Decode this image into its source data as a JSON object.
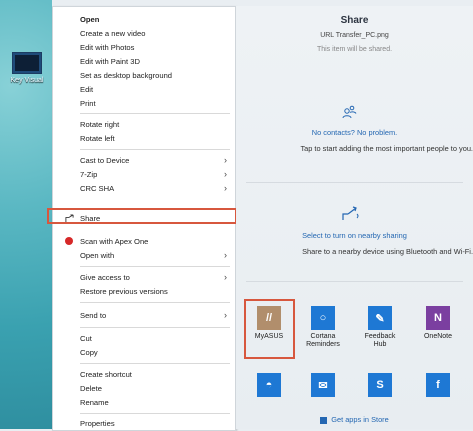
{
  "desktop": {
    "item_label": "Key Visual"
  },
  "context_menu": {
    "items": [
      {
        "label": "Open",
        "bold": true
      },
      {
        "label": "Create a new video"
      },
      {
        "label": "Edit with Photos"
      },
      {
        "label": "Edit with Paint 3D"
      },
      {
        "label": "Set as desktop background"
      },
      {
        "label": "Edit"
      },
      {
        "label": "Print"
      },
      {
        "label": "Rotate right"
      },
      {
        "label": "Rotate left"
      },
      {
        "label": "Cast to Device",
        "submenu": true
      },
      {
        "label": "7-Zip",
        "submenu": true
      },
      {
        "label": "CRC SHA",
        "submenu": true
      },
      {
        "label": "Share",
        "icon": "share-icon"
      },
      {
        "label": "Scan with Apex One",
        "icon": "apex-one-icon"
      },
      {
        "label": "Open with",
        "submenu": true
      },
      {
        "label": "Give access to",
        "submenu": true
      },
      {
        "label": "Restore previous versions"
      },
      {
        "label": "Send to",
        "submenu": true
      },
      {
        "label": "Cut"
      },
      {
        "label": "Copy"
      },
      {
        "label": "Create shortcut"
      },
      {
        "label": "Delete"
      },
      {
        "label": "Rename"
      },
      {
        "label": "Properties"
      }
    ],
    "highlight_color": "#d7573e"
  },
  "share_panel": {
    "title": "Share",
    "file_name": "URL Transfer_PC.png",
    "subtitle": "This item will be shared.",
    "contacts": {
      "title": "No contacts? No problem.",
      "description": "Tap to start adding the most important people to you."
    },
    "nearby": {
      "title": "Select to turn on nearby sharing",
      "description": "Share to a nearby device using Bluetooth and Wi-Fi."
    },
    "apps": [
      {
        "label": "MyASUS",
        "icon": "myasus-icon",
        "color": "#b18e6c",
        "glyph": "//"
      },
      {
        "label": "Cortana Reminders",
        "icon": "cortana-icon",
        "color": "#1e78d4",
        "glyph": "○"
      },
      {
        "label": "Feedback Hub",
        "icon": "feedback-hub-icon",
        "color": "#1e78d4",
        "glyph": "👤"
      },
      {
        "label": "OneNote",
        "icon": "onenote-icon",
        "color": "#7b3fa0",
        "glyph": "N"
      },
      {
        "label": "",
        "icon": "app-icon-5",
        "color": "#1e78d4",
        "glyph": "◓"
      },
      {
        "label": "",
        "icon": "mail-icon",
        "color": "#1e78d4",
        "glyph": "✉"
      },
      {
        "label": "",
        "icon": "skype-icon",
        "color": "#1e78d4",
        "glyph": "S"
      },
      {
        "label": "",
        "icon": "facebook-icon",
        "color": "#1e78d4",
        "glyph": "f"
      }
    ],
    "get_apps": "Get apps in Store"
  }
}
